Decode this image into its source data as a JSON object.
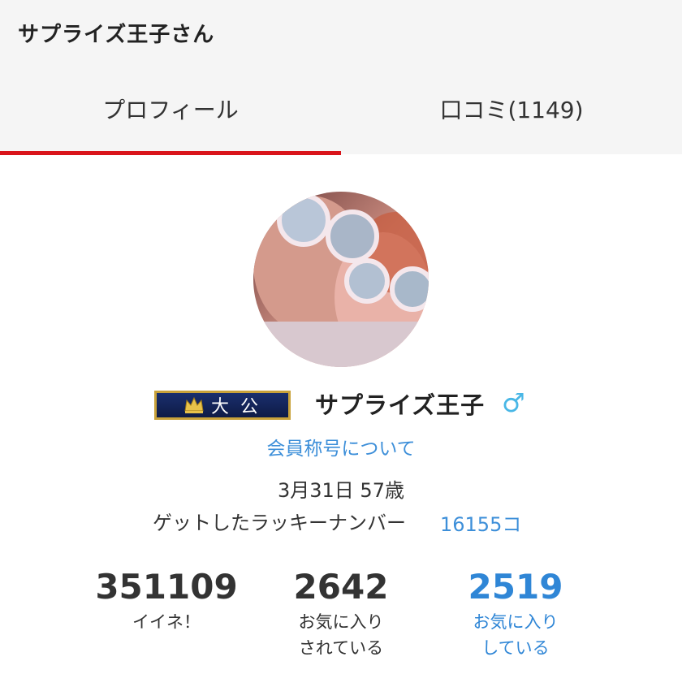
{
  "header": {
    "title": "サプライズ王子さん",
    "tabs": [
      {
        "label": "プロフィール",
        "active": true
      },
      {
        "label": "口コミ(1149)",
        "active": false
      }
    ],
    "accent_color": "#d9141b"
  },
  "profile": {
    "avatar_icon": "user-photo",
    "rank_badge": "大公",
    "username": "サプライズ王子",
    "gender_icon": "♂",
    "title_link": "会員称号について",
    "birthday": "3月31日 57歳",
    "lucky_label": "ゲットしたラッキーナンバー",
    "lucky_value": "16155コ",
    "link_color": "#3d8fd9"
  },
  "stats": [
    {
      "value": "351109",
      "label_line1": "イイネ！",
      "label_line2": ""
    },
    {
      "value": "2642",
      "label_line1": "お気に入り",
      "label_line2": "されている"
    },
    {
      "value": "2519",
      "label_line1": "お気に入り",
      "label_line2": "している"
    }
  ]
}
